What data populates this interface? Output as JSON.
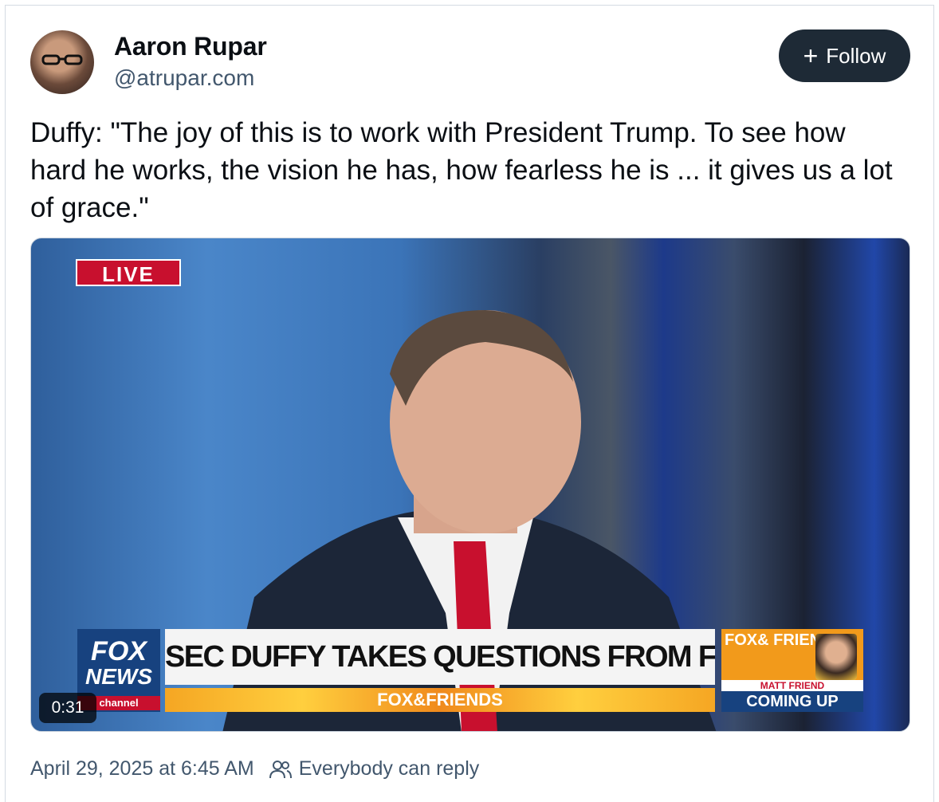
{
  "author": {
    "name": "Aaron Rupar",
    "handle": "@atrupar.com"
  },
  "follow": {
    "icon": "plus-icon",
    "label": "Follow"
  },
  "post": {
    "text": "Duffy: \"The joy of this is to work with President Trump. To see how hard he works, the vision he has, how fearless he is ... it gives us a lot of grace.\""
  },
  "video": {
    "live_label": "LIVE",
    "logo": {
      "fox": "FOX",
      "news": "NEWS",
      "channel": "channel"
    },
    "headline": "SEC DUFFY TAKES QUESTIONS FROM F&F LIVE AUDIENCE",
    "show": "FOX&FRIENDS",
    "promo": {
      "brand": "FOX& FRIENDS",
      "name": "MATT FRIEND",
      "coming": "COMING UP"
    },
    "timer": "0:31"
  },
  "meta": {
    "timestamp": "April 29, 2025 at 6:45 AM",
    "reply_icon": "people-icon",
    "reply_setting": "Everybody can reply"
  }
}
